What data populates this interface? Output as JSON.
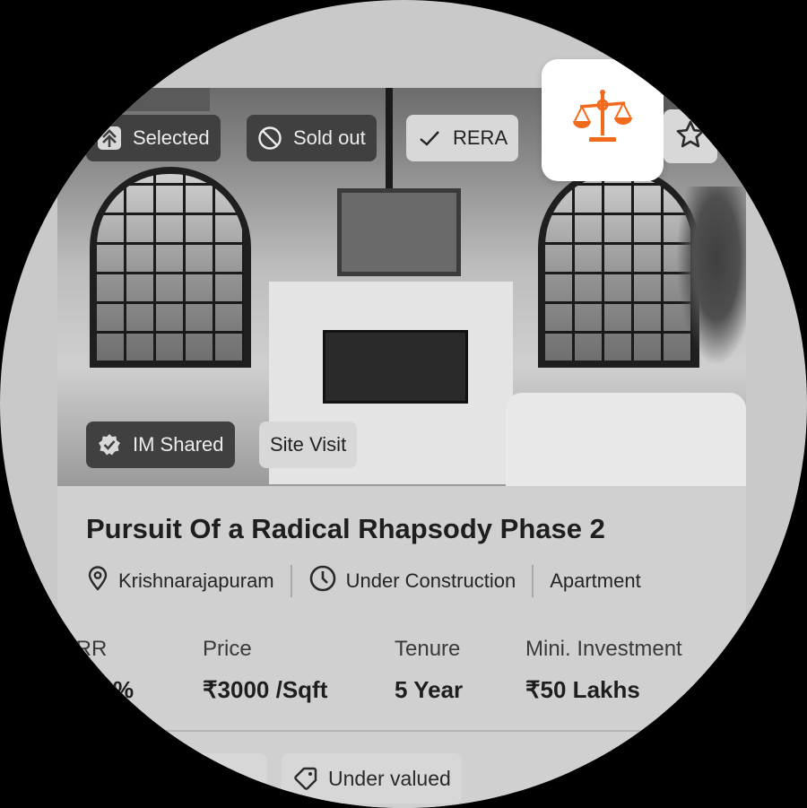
{
  "top_badges": {
    "selected": "Selected",
    "sold_out": "Sold out",
    "rera": "RERA"
  },
  "photo_badges": {
    "im_shared": "IM Shared",
    "site_visit": "Site Visit"
  },
  "property": {
    "title": "Pursuit Of a Radical Rhapsody Phase 2",
    "location": "Krishnarajapuram",
    "status": "Under Construction",
    "type": "Apartment"
  },
  "stats": {
    "irr_label": "IRR",
    "irr_value": "%",
    "price_label": "Price",
    "price_value": "₹3000 /Sqft",
    "tenure_label": "Tenure",
    "tenure_value": "5 Year",
    "investment_label": "Mini. Investment",
    "investment_value": "₹50 Lakhs"
  },
  "tags": {
    "under_valued": "Under valued"
  },
  "colors": {
    "accent": "#f26b1d",
    "circle_bg": "#c9c9c9",
    "card_bg": "#d0d0d0"
  },
  "icons": [
    "selected-arrow-icon",
    "block-icon",
    "check-icon",
    "scale-icon",
    "star-icon",
    "verified-badge-icon",
    "location-pin-icon",
    "clock-icon",
    "tag-icon"
  ]
}
